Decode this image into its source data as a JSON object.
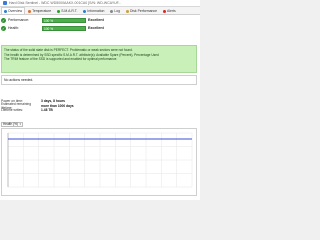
{
  "window": {
    "title": "Hard Disk Sentinel - WDC WD5000AAKX-001CA0 [S/N: WD-WCAYUF..."
  },
  "tabs": [
    {
      "label": "Overview",
      "icon": "overview-icon",
      "color": "#2a7fd4"
    },
    {
      "label": "Temperature",
      "icon": "temperature-icon",
      "color": "#e0702a"
    },
    {
      "label": "S.M.A.R.T.",
      "icon": "smart-icon",
      "color": "#2aa02a"
    },
    {
      "label": "Information",
      "icon": "information-icon",
      "color": "#2a7fd4"
    },
    {
      "label": "Log",
      "icon": "log-icon",
      "color": "#888888"
    },
    {
      "label": "Disk Performance",
      "icon": "performance-icon",
      "color": "#d4a02a"
    },
    {
      "label": "Alerts",
      "icon": "alerts-icon",
      "color": "#d42a2a"
    }
  ],
  "overview": {
    "performance": {
      "label": "Performance:",
      "bar_text": "100 %",
      "rating": "Excellent",
      "value_percent": 100
    },
    "health": {
      "label": "Health:",
      "bar_text": "100 %",
      "rating": "Excellent",
      "value_percent": 100
    },
    "status_lines": [
      "The status of the solid state disk is PERFECT. Problematic or weak sectors were not found.",
      "The health is determined by SSD specific S.M.A.R.T. attribute(s): Available Spare (Percent), Percentage Used",
      "The TRIM feature of the SSD is supported and enabled for optimal performance."
    ],
    "actions_text": "No actions needed.",
    "info": [
      {
        "key": "Power on time:",
        "value": "3 days, 8 hours"
      },
      {
        "key": "Estimated remaining lifetime:",
        "value": "more than 1000 days"
      },
      {
        "key": "Lifetime writes:",
        "value": "1.48 TB"
      }
    ],
    "chart_select": "Health (%)"
  },
  "colors": {
    "status_bg": "#c8f0b8",
    "bar_green": "#4caf4c",
    "chart_line": "#3a4fd4"
  },
  "chart_data": {
    "type": "line",
    "series": [
      {
        "values": [
          100,
          100
        ]
      }
    ],
    "ylim": [
      0,
      100
    ],
    "grid": true
  }
}
